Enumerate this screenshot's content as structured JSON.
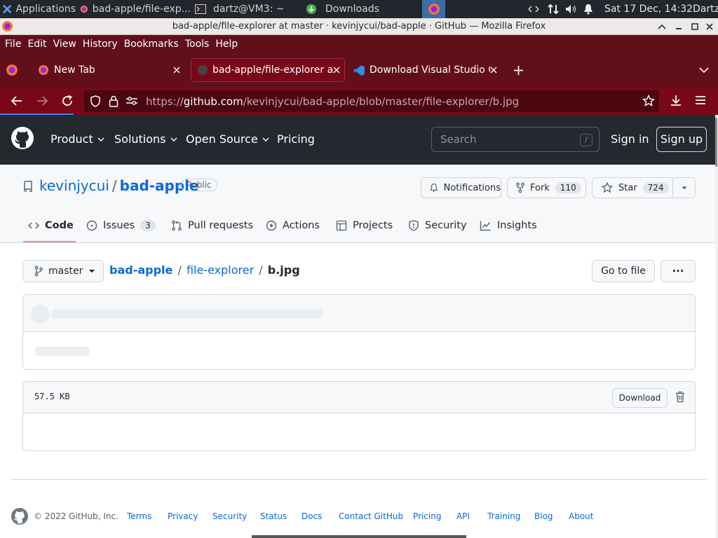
{
  "taskbar": {
    "apps_label": "Applications",
    "tasks": [
      {
        "label": "bad-apple/file-exp...",
        "icon": "firefox-icon"
      },
      {
        "label": "dartz@VM3: ~",
        "icon": "terminal-icon"
      },
      {
        "label": "Downloads",
        "icon": "download-icon"
      }
    ],
    "clock": "Sat 17 Dec, 14:32",
    "user": "Dartz"
  },
  "window": {
    "title": "bad-apple/file-explorer at master · kevinjycui/bad-apple · GitHub — Mozilla Firefox"
  },
  "menu": [
    "File",
    "Edit",
    "View",
    "History",
    "Bookmarks",
    "Tools",
    "Help"
  ],
  "tabs": [
    {
      "label": "New Tab",
      "icon": "firefox-icon"
    },
    {
      "label": "bad-apple/file-explorer at",
      "icon": "github-icon"
    },
    {
      "label": "Download Visual Studio C",
      "icon": "vscode-icon"
    }
  ],
  "url": {
    "prefix": "https://",
    "host": "github.com",
    "path": "/kevinjycui/bad-apple/blob/master/file-explorer/b.jpg"
  },
  "gh_header": {
    "nav": [
      "Product",
      "Solutions",
      "Open Source",
      "Pricing"
    ],
    "search_placeholder": "Search",
    "search_key": "/",
    "sign_in": "Sign in",
    "sign_up": "Sign up"
  },
  "repo": {
    "owner": "kevinjycui",
    "separator": "/",
    "name": "bad-apple",
    "visibility": "Public",
    "notifications": "Notifications",
    "fork_label": "Fork",
    "fork_count": "110",
    "star_label": "Star",
    "star_count": "724",
    "tabs": [
      {
        "label": "Code",
        "icon": "code-icon"
      },
      {
        "label": "Issues",
        "icon": "issue-icon",
        "count": "3"
      },
      {
        "label": "Pull requests",
        "icon": "pull-request-icon"
      },
      {
        "label": "Actions",
        "icon": "play-icon"
      },
      {
        "label": "Projects",
        "icon": "table-icon"
      },
      {
        "label": "Security",
        "icon": "shield-icon"
      },
      {
        "label": "Insights",
        "icon": "graph-icon"
      }
    ]
  },
  "file": {
    "branch": "master",
    "crumbs": [
      "bad-apple",
      "/",
      "file-explorer",
      "/",
      "b.jpg"
    ],
    "go_to_file": "Go to file",
    "more": "···",
    "size": "57.5 KB",
    "download": "Download"
  },
  "footer": {
    "copyright": "© 2022 GitHub, Inc.",
    "links": [
      "Terms",
      "Privacy",
      "Security",
      "Status",
      "Docs",
      "Contact GitHub",
      "Pricing",
      "API",
      "Training",
      "Blog",
      "About"
    ]
  },
  "colors": {
    "firefox_theme": "#780818",
    "github_header": "#24292f",
    "link": "#0969da"
  }
}
